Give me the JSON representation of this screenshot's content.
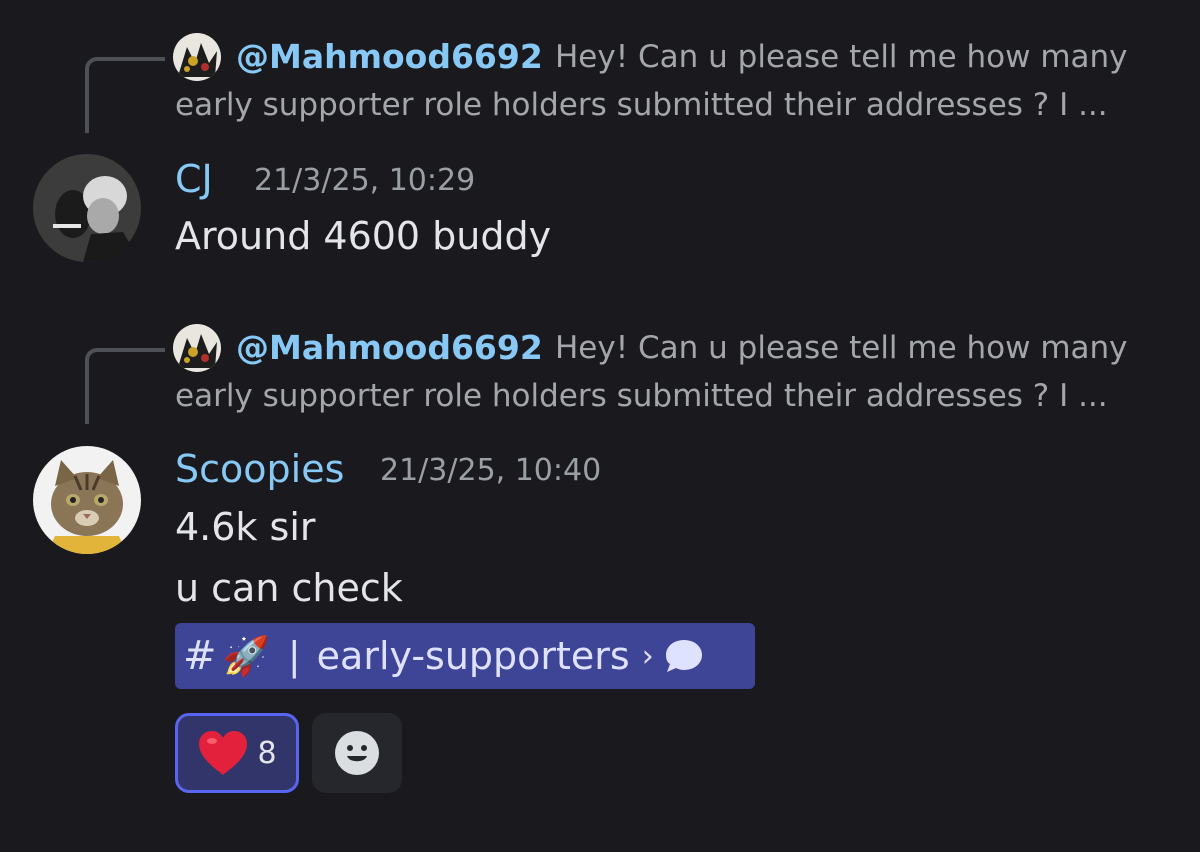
{
  "messages": [
    {
      "reply": {
        "mention": "@Mahmood6692",
        "preview_line1": "Hey! Can u please tell me how many",
        "preview_line2": "early supporter role holders submitted their addresses ? I ...",
        "avatar_icon": "anime-avatar-icon"
      },
      "author": "CJ",
      "timestamp": "21/3/25, 10:29",
      "lines": [
        "Around 4600 buddy"
      ],
      "avatar_icon": "bw-photo-avatar"
    },
    {
      "reply": {
        "mention": "@Mahmood6692",
        "preview_line1": "Hey! Can u please tell me how many",
        "preview_line2": "early supporter role holders submitted their addresses ? I ...",
        "avatar_icon": "anime-avatar-icon"
      },
      "author": "Scoopies",
      "timestamp": "21/3/25, 10:40",
      "lines": [
        "4.6k sir",
        "u can check"
      ],
      "avatar_icon": "cat-avatar",
      "channel_mention": {
        "hash": "#",
        "emoji": "🚀",
        "separator": "|",
        "name": "early-supporters",
        "chevron": "›",
        "icon": "chat-bubble-icon"
      },
      "reactions": [
        {
          "emoji": "❤️",
          "count": "8",
          "icon": "heart-icon"
        }
      ],
      "add_reaction_icon": "smiley-icon"
    }
  ],
  "colors": {
    "background": "#1a1a1e",
    "username": "#87c8f5",
    "mention_bg": "#3f4596",
    "reaction_border": "#5865f2"
  }
}
